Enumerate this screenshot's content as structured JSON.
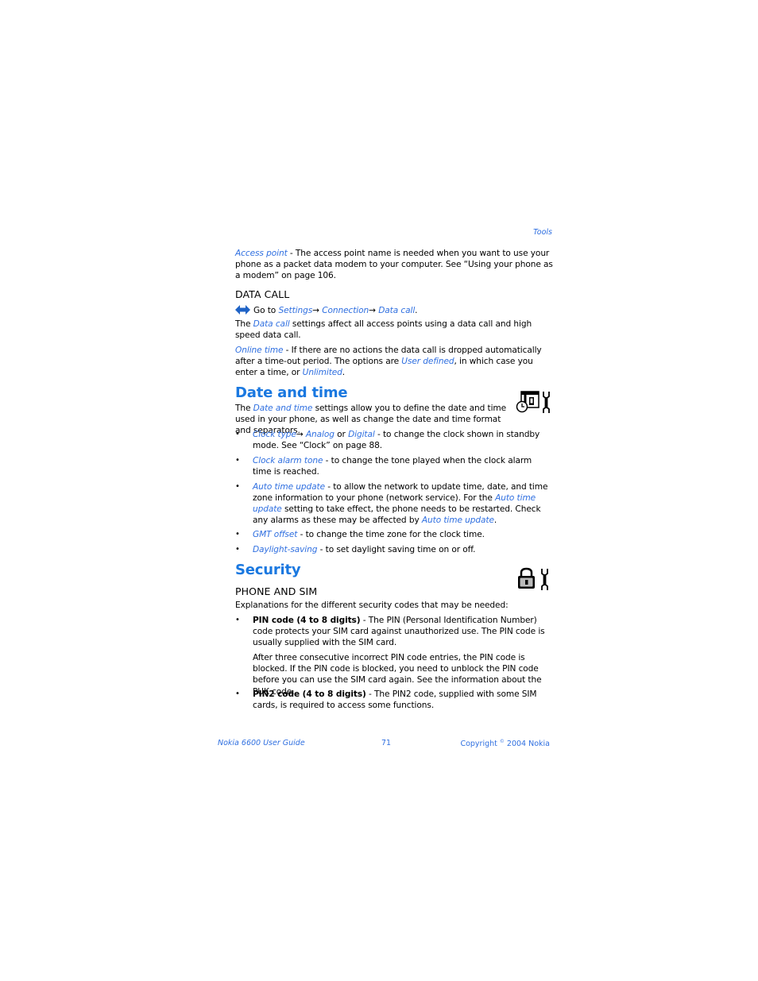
{
  "running_header": "Tools",
  "access_point": {
    "term": "Access point",
    "text": " - The access point name is needed when you want to use your phone as a packet data modem to your computer. See “Using your phone as a modem” on page 106."
  },
  "data_call": {
    "heading": "DATA CALL",
    "nav": {
      "prefix": "Go to ",
      "path": [
        "Settings",
        "Connection",
        "Data call"
      ],
      "arrow": "→",
      "suffix": "."
    },
    "para1": {
      "pre": "The ",
      "term": "Data call",
      "post": " settings affect all access points using a data call and high speed data call."
    },
    "online_time": {
      "term": "Online time",
      "text1": " - If there are no actions the data call is dropped automatically after a time-out period. The options are ",
      "opt1": "User defined",
      "text2": ", in which case you enter a time, or ",
      "opt2": "Unlimited",
      "text3": "."
    }
  },
  "date_time": {
    "heading": "Date and time",
    "intro": {
      "pre": "The ",
      "term": "Date and time",
      "post": " settings allow you to define the date and time used in your phone, as well as change the date and time format and separators."
    },
    "items": [
      {
        "term": "Clock type",
        "arrow": "→ ",
        "opt1": "Analog",
        "or": " or ",
        "opt2": "Digital",
        "text": " - to change the clock shown in standby mode. See “Clock” on page 88."
      },
      {
        "term": "Clock alarm tone",
        "text": " - to change the tone played when the clock alarm time is reached."
      },
      {
        "term": "Auto time update",
        "text1": " - to allow the network to update time, date, and time zone information to your phone (network service). For the ",
        "term2": "Auto time update",
        "text2": " setting to take effect, the phone needs to be restarted. Check any alarms as these may be affected by ",
        "term3": "Auto time update",
        "text3": "."
      },
      {
        "term": "GMT offset",
        "text": " - to change the time zone for the clock time."
      },
      {
        "term": "Daylight-saving",
        "text": " - to set daylight saving time on or off."
      }
    ]
  },
  "security": {
    "heading": "Security",
    "subheading": "PHONE AND SIM",
    "intro": "Explanations for the different security codes that may be needed:",
    "items": [
      {
        "term": "PIN code (4 to 8 digits)",
        "text": " - The PIN (Personal Identification Number) code protects your SIM card against unauthorized use. The PIN code is usually supplied with the SIM card.",
        "extra": "After three consecutive incorrect PIN code entries, the PIN code is blocked. If the PIN code is blocked, you need to unblock the PIN code before you can use the SIM card again. See the information about the PUK code."
      },
      {
        "term": "PIN2 code (4 to 8 digits)",
        "text": " - The PIN2 code, supplied with some SIM cards, is required to access some functions."
      }
    ]
  },
  "bullet_char": "•",
  "icons": {
    "nav": "navigation-arrow-icon",
    "date_time": "clock-settings-icon",
    "security": "padlock-settings-icon"
  },
  "footer": {
    "left": "Nokia 6600 User Guide",
    "page": "71",
    "right_pre": "Copyright ",
    "copy_sym": "©",
    "right_post": " 2004 Nokia"
  },
  "colors": {
    "link": "#2f6fe0",
    "heading": "#1a78e0"
  }
}
